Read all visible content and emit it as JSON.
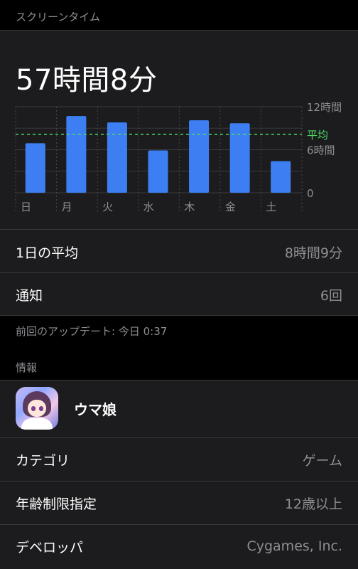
{
  "header": {
    "title": "スクリーンタイム"
  },
  "summary": {
    "total": "57時間8分"
  },
  "chart_data": {
    "type": "bar",
    "categories": [
      "日",
      "月",
      "火",
      "水",
      "木",
      "金",
      "土"
    ],
    "values": [
      6.9,
      10.7,
      9.8,
      5.9,
      10.1,
      9.7,
      4.4
    ],
    "average": 8.15,
    "average_label": "平均",
    "ylim": [
      0,
      12
    ],
    "yticks": [
      {
        "value": 12,
        "label": "12時間"
      },
      {
        "value": 6,
        "label": "6時間"
      },
      {
        "value": 0,
        "label": "0"
      }
    ],
    "bar_color": "#3d7ff2",
    "average_color": "#4cd964",
    "grid": true
  },
  "stats": {
    "daily_average_label": "1日の平均",
    "daily_average_value": "8時間9分",
    "notifications_label": "通知",
    "notifications_value": "6回"
  },
  "footnote": "前回のアップデート: 今日 0:37",
  "info": {
    "section_title": "情報",
    "app_name": "ウマ娘",
    "app_icon": "uma-musume-app-icon",
    "category_label": "カテゴリ",
    "category_value": "ゲーム",
    "age_rating_label": "年齢制限指定",
    "age_rating_value": "12歳以上",
    "developer_label": "デベロッパ",
    "developer_value": "Cygames, Inc."
  }
}
